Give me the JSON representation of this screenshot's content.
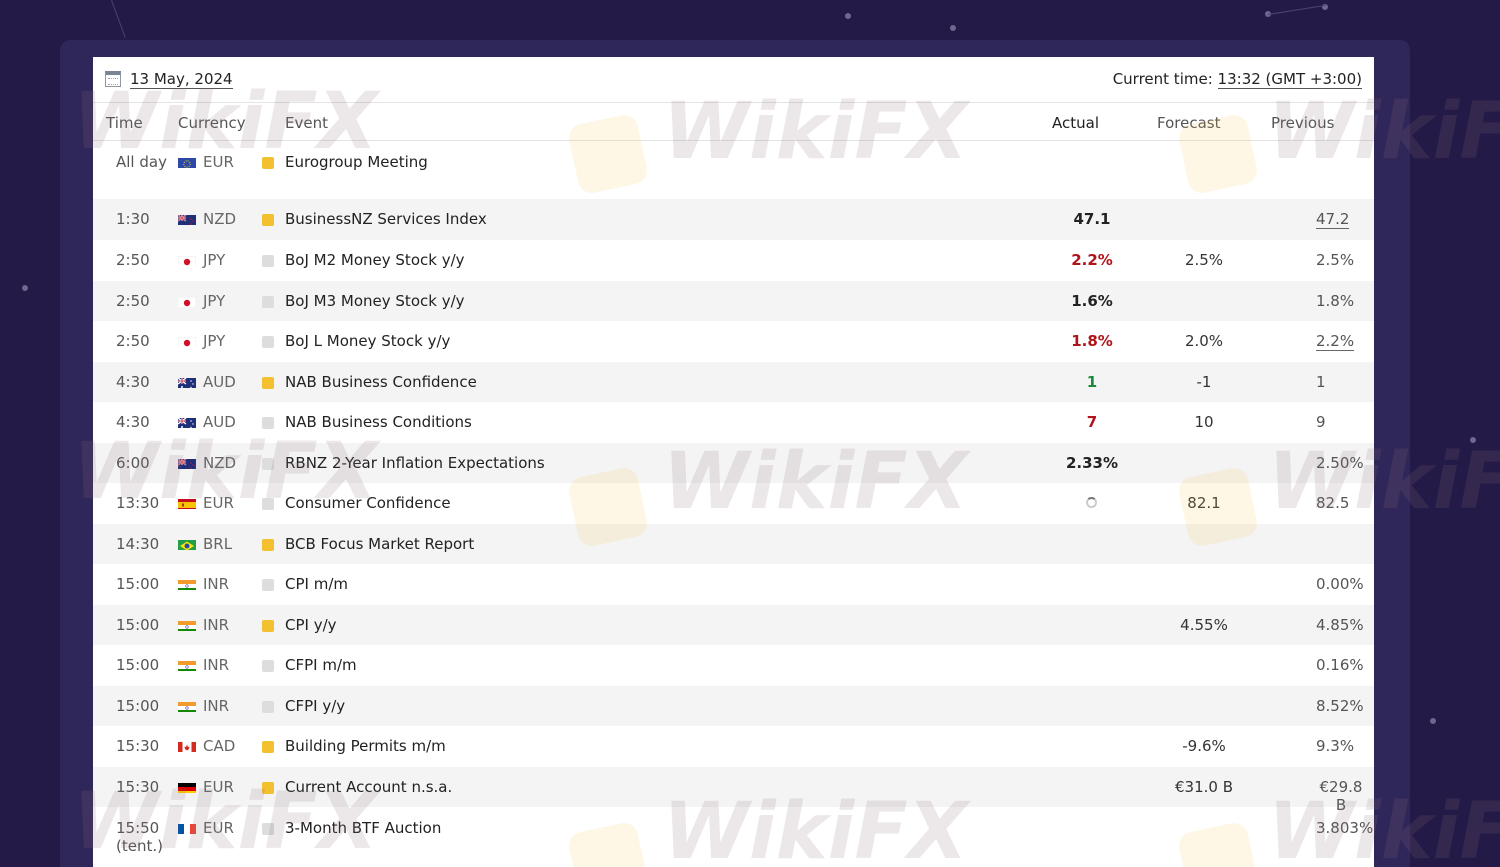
{
  "header": {
    "date": "13 May, 2024",
    "current_time_label": "Current time:",
    "current_time_value": "13:32 (GMT +3:00)"
  },
  "columns": {
    "time": "Time",
    "currency": "Currency",
    "event": "Event",
    "actual": "Actual",
    "forecast": "Forecast",
    "previous": "Previous"
  },
  "watermark": "WikiFX",
  "rows": [
    {
      "time": "All day",
      "flag": "eu",
      "currency": "EUR",
      "importance": "medium",
      "event": "Eurogroup Meeting",
      "actual": "",
      "forecast": "",
      "previous": ""
    },
    {
      "time": "1:30",
      "flag": "nz",
      "currency": "NZD",
      "importance": "medium",
      "event": "BusinessNZ Services Index",
      "actual": "47.1",
      "forecast": "",
      "previous": "47.2"
    },
    {
      "time": "2:50",
      "flag": "jp",
      "currency": "JPY",
      "importance": "low",
      "event": "BoJ M2 Money Stock y/y",
      "actual": "2.2%",
      "forecast": "2.5%",
      "previous": "2.5%"
    },
    {
      "time": "2:50",
      "flag": "jp",
      "currency": "JPY",
      "importance": "low",
      "event": "BoJ M3 Money Stock y/y",
      "actual": "1.6%",
      "forecast": "",
      "previous": "1.8%"
    },
    {
      "time": "2:50",
      "flag": "jp",
      "currency": "JPY",
      "importance": "low",
      "event": "BoJ L Money Stock y/y",
      "actual": "1.8%",
      "forecast": "2.0%",
      "previous": "2.2%"
    },
    {
      "time": "4:30",
      "flag": "au",
      "currency": "AUD",
      "importance": "medium",
      "event": "NAB Business Confidence",
      "actual": "1",
      "forecast": "-1",
      "previous": "1"
    },
    {
      "time": "4:30",
      "flag": "au",
      "currency": "AUD",
      "importance": "low",
      "event": "NAB Business Conditions",
      "actual": "7",
      "forecast": "10",
      "previous": "9"
    },
    {
      "time": "6:00",
      "flag": "nz",
      "currency": "NZD",
      "importance": "low",
      "event": "RBNZ 2-Year Inflation Expectations",
      "actual": "2.33%",
      "forecast": "",
      "previous": "2.50%"
    },
    {
      "time": "13:30",
      "flag": "es",
      "currency": "EUR",
      "importance": "low",
      "event": "Consumer Confidence",
      "actual": "",
      "forecast": "82.1",
      "previous": "82.5"
    },
    {
      "time": "14:30",
      "flag": "br",
      "currency": "BRL",
      "importance": "medium",
      "event": "BCB Focus Market Report",
      "actual": "",
      "forecast": "",
      "previous": ""
    },
    {
      "time": "15:00",
      "flag": "in",
      "currency": "INR",
      "importance": "low",
      "event": "CPI m/m",
      "actual": "",
      "forecast": "",
      "previous": "0.00%"
    },
    {
      "time": "15:00",
      "flag": "in",
      "currency": "INR",
      "importance": "medium",
      "event": "CPI y/y",
      "actual": "",
      "forecast": "4.55%",
      "previous": "4.85%"
    },
    {
      "time": "15:00",
      "flag": "in",
      "currency": "INR",
      "importance": "low",
      "event": "CFPI m/m",
      "actual": "",
      "forecast": "",
      "previous": "0.16%"
    },
    {
      "time": "15:00",
      "flag": "in",
      "currency": "INR",
      "importance": "low",
      "event": "CFPI y/y",
      "actual": "",
      "forecast": "",
      "previous": "8.52%"
    },
    {
      "time": "15:30",
      "flag": "ca",
      "currency": "CAD",
      "importance": "medium",
      "event": "Building Permits m/m",
      "actual": "",
      "forecast": "-9.6%",
      "previous": "9.3%"
    },
    {
      "time": "15:30",
      "flag": "de",
      "currency": "EUR",
      "importance": "medium",
      "event": "Current Account n.s.a.",
      "actual": "",
      "forecast": "€31.0 B",
      "previous": "€29.8 B"
    },
    {
      "time": "15:50 (tent.)",
      "flag": "fr",
      "currency": "EUR",
      "importance": "low",
      "event": "3-Month BTF Auction",
      "actual": "",
      "forecast": "",
      "previous": "3.803%"
    }
  ]
}
